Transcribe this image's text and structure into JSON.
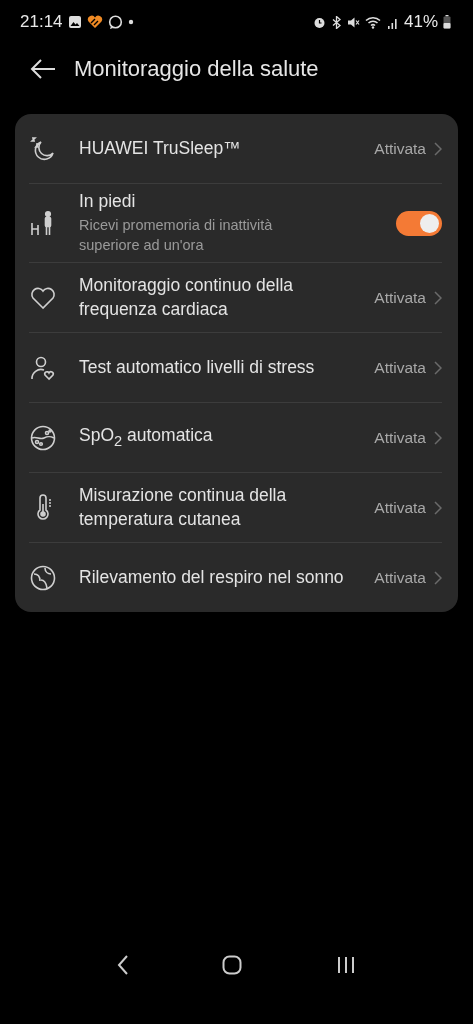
{
  "status_bar": {
    "time": "21:14",
    "battery": "41%"
  },
  "header": {
    "title": "Monitoraggio della salute"
  },
  "settings": [
    {
      "kind": "link",
      "title": "HUAWEI TruSleep™",
      "value": "Attivata"
    },
    {
      "kind": "toggle",
      "title": "In piedi",
      "subtitle": "Ricevi promemoria di inattività superiore ad un'ora",
      "on": true
    },
    {
      "kind": "link",
      "title": "Monitoraggio continuo della frequenza cardiaca",
      "value": "Attivata"
    },
    {
      "kind": "link",
      "title": "Test automatico livelli di stress",
      "value": "Attivata"
    },
    {
      "kind": "link",
      "title": "SpO$_{2}$ automatica",
      "value": "Attivata"
    },
    {
      "kind": "link",
      "title": "Misurazione continua della temperatura cutanea",
      "value": "Attivata"
    },
    {
      "kind": "link",
      "title": "Rilevamento del respiro nel sonno",
      "value": "Attivata"
    }
  ]
}
